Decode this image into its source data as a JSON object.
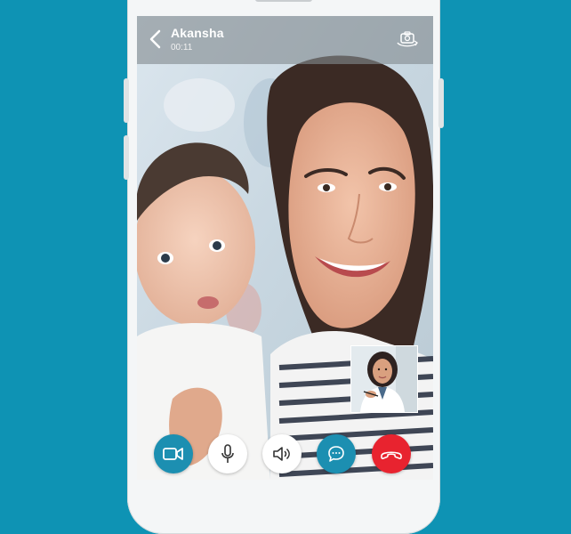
{
  "call": {
    "caller_name": "Akansha",
    "timer": "00:11"
  },
  "icons": {
    "back": "chevron-left-icon",
    "camera_switch": "camera-rotate-icon",
    "video": "video-camera-icon",
    "mic": "microphone-icon",
    "speaker": "speaker-icon",
    "chat": "chat-bubble-icon",
    "end_call": "phone-hangup-icon"
  },
  "colors": {
    "background": "#0e93b4",
    "video_button": "#1c8fb1",
    "chat_button": "#1c8fb1",
    "end_call_button": "#e8232f",
    "neutral_button": "#ffffff"
  }
}
